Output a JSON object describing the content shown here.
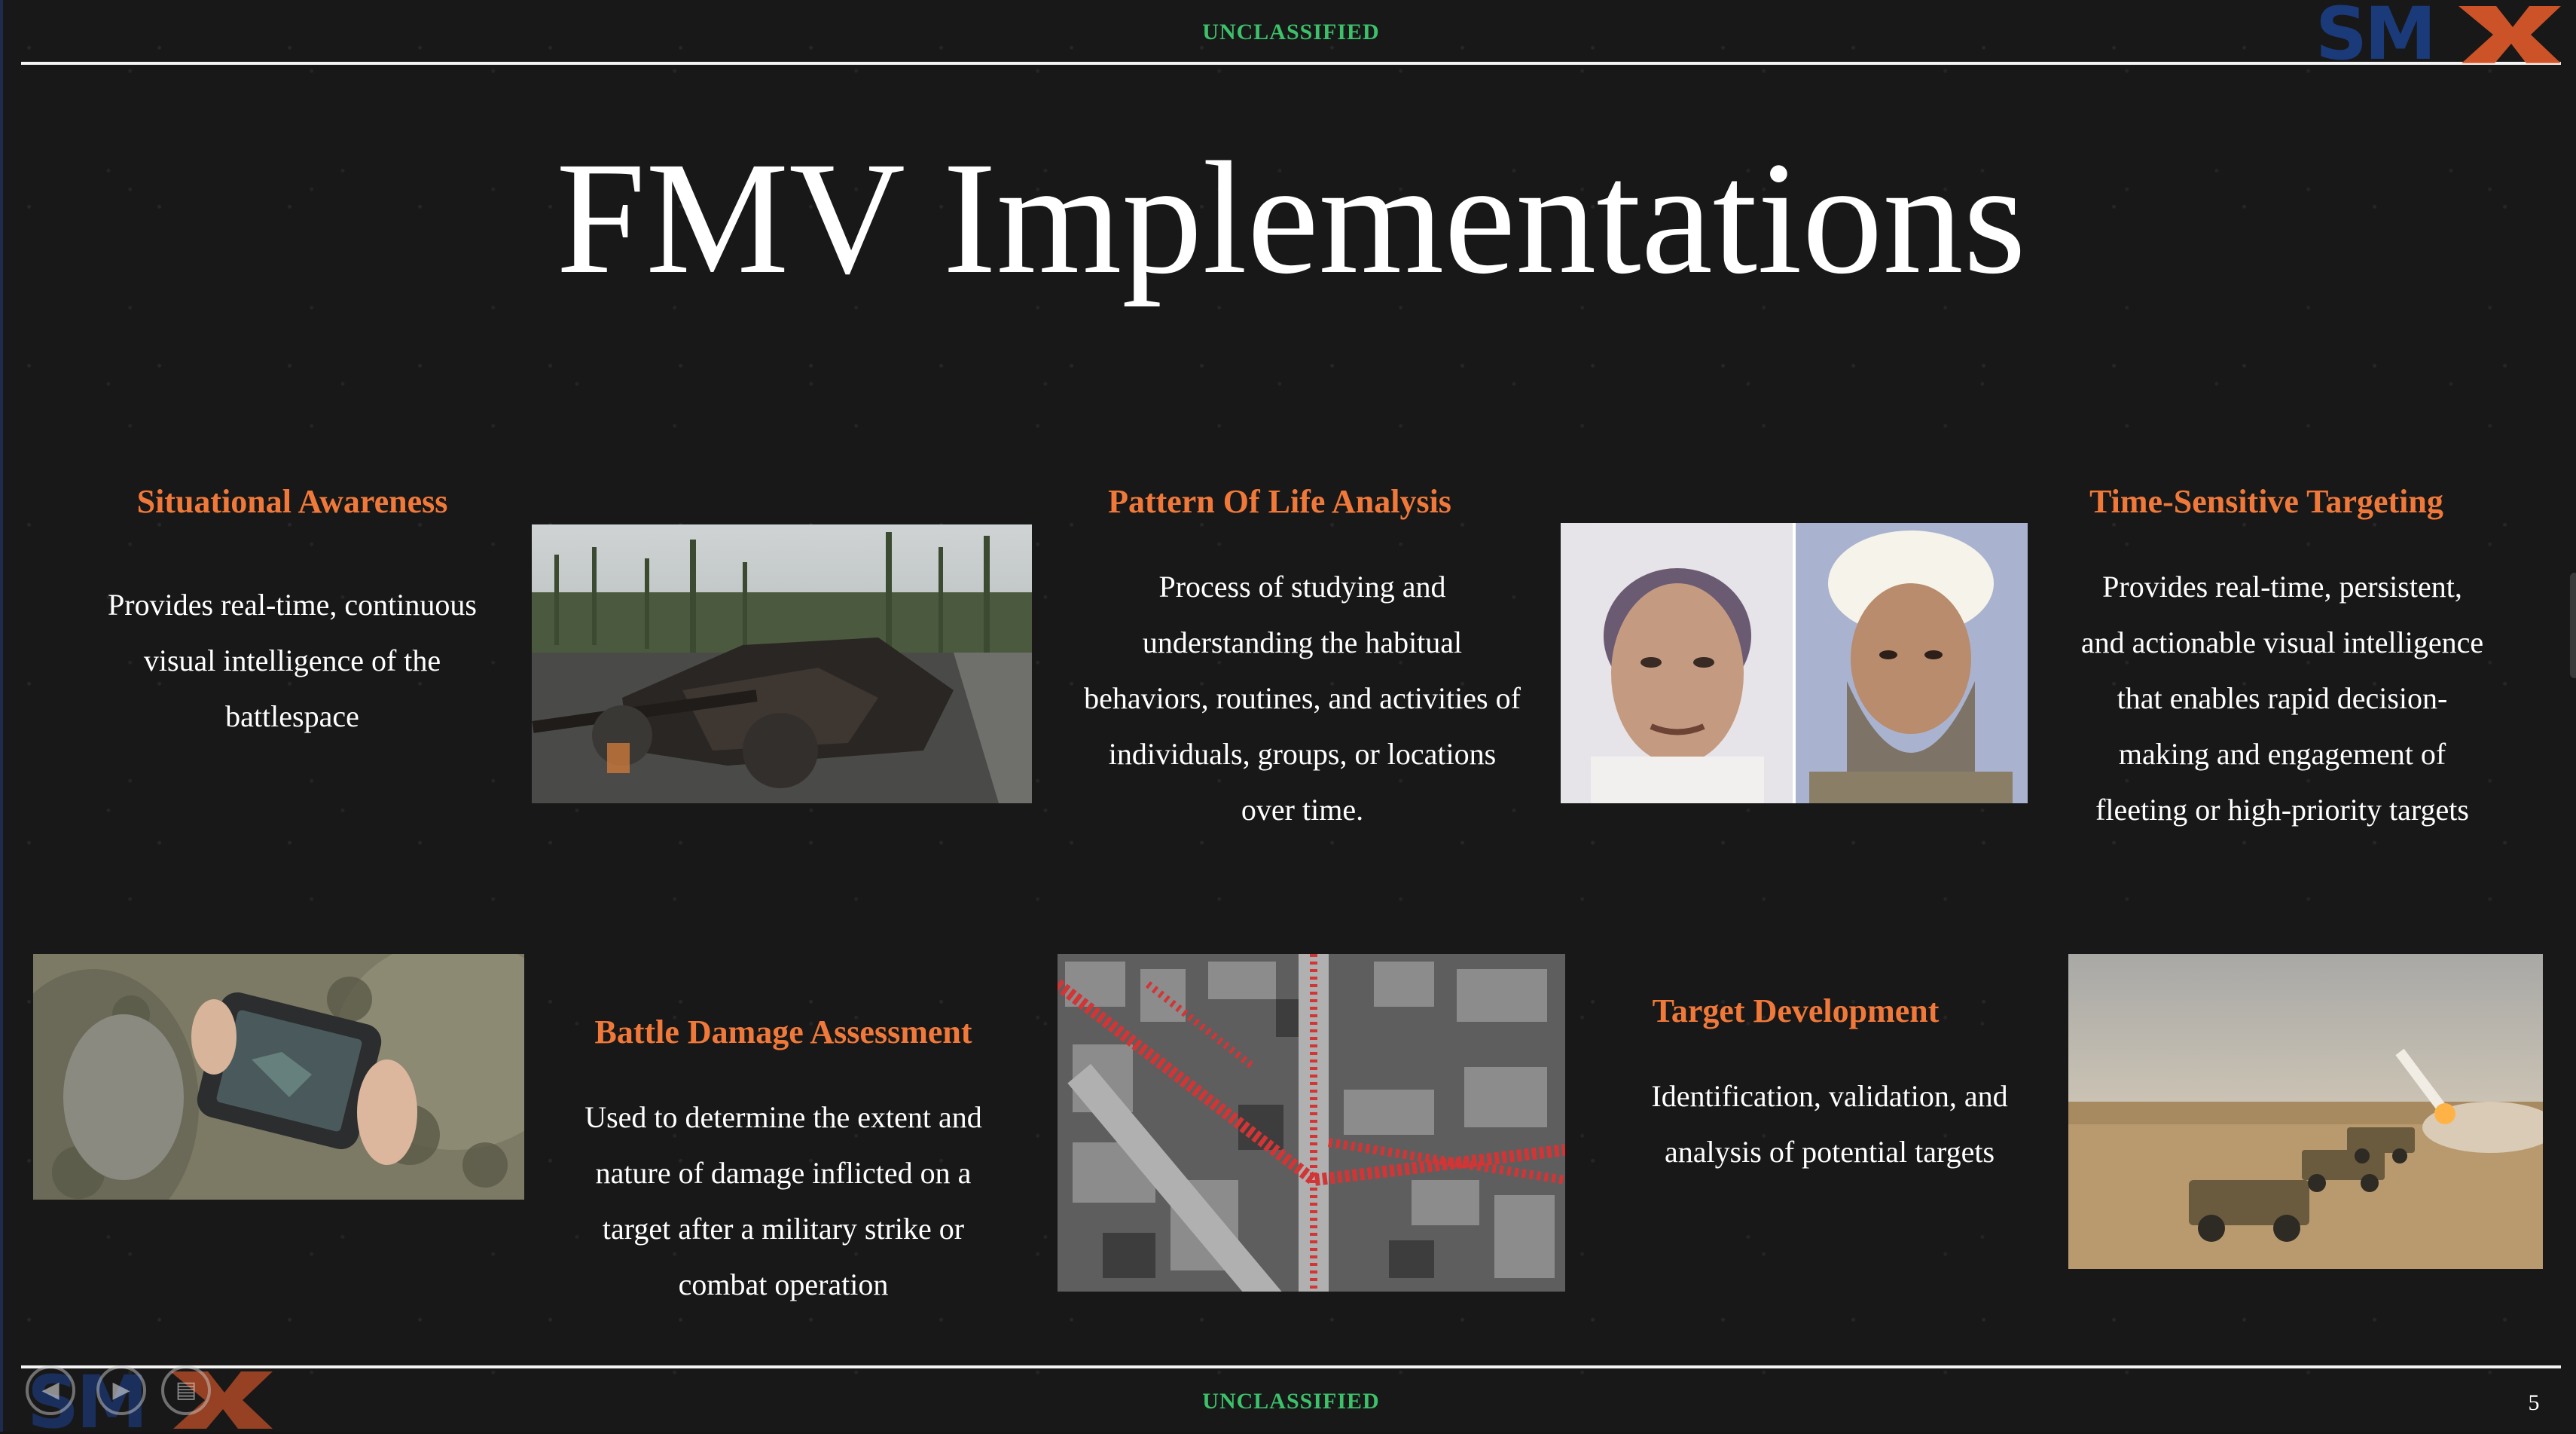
{
  "slide": {
    "classification_top": "UNCLASSIFIED",
    "classification_bottom": "UNCLASSIFIED",
    "title": "FMV Implementations",
    "page_number": "5",
    "logo_text": "SMX"
  },
  "sections": {
    "situational_awareness": {
      "heading": "Situational Awareness",
      "body_lines": [
        "Provides real-time, continuous",
        "visual intelligence of the",
        "battlespace"
      ]
    },
    "pattern_of_life": {
      "heading": "Pattern Of Life Analysis",
      "body_lines": [
        "Process of studying and",
        "understanding the habitual",
        "behaviors, routines, and activities of",
        "individuals, groups, or locations",
        "over time."
      ]
    },
    "time_sensitive": {
      "heading": "Time-Sensitive Targeting",
      "body_lines": [
        "Provides real-time, persistent,",
        "and actionable visual intelligence",
        "that enables rapid decision-",
        "making and engagement of",
        "fleeting or high-priority targets"
      ]
    },
    "battle_damage": {
      "heading": "Battle Damage Assessment",
      "body_lines": [
        "Used to determine the extent and",
        "nature of damage inflicted on a",
        "target after a military strike or",
        "combat operation"
      ]
    },
    "target_development": {
      "heading": "Target Development",
      "body_lines": [
        "Identification, validation, and",
        "analysis of potential targets"
      ]
    }
  },
  "images": {
    "destroyed_tank": "destroyed-tank-photo",
    "face_comparison": "face-comparison-photo",
    "soldier_tablet": "soldier-tablet-photo",
    "aerial_city": "aerial-city-map-photo",
    "rocket_launch": "rocket-launch-photo"
  },
  "colors": {
    "heading": "#f0793a",
    "classification": "#3cc06a",
    "background": "#181818",
    "text": "#ffffff"
  },
  "controls": {
    "prev_icon": "◀",
    "play_icon": "▶",
    "menu_icon": "▤"
  }
}
